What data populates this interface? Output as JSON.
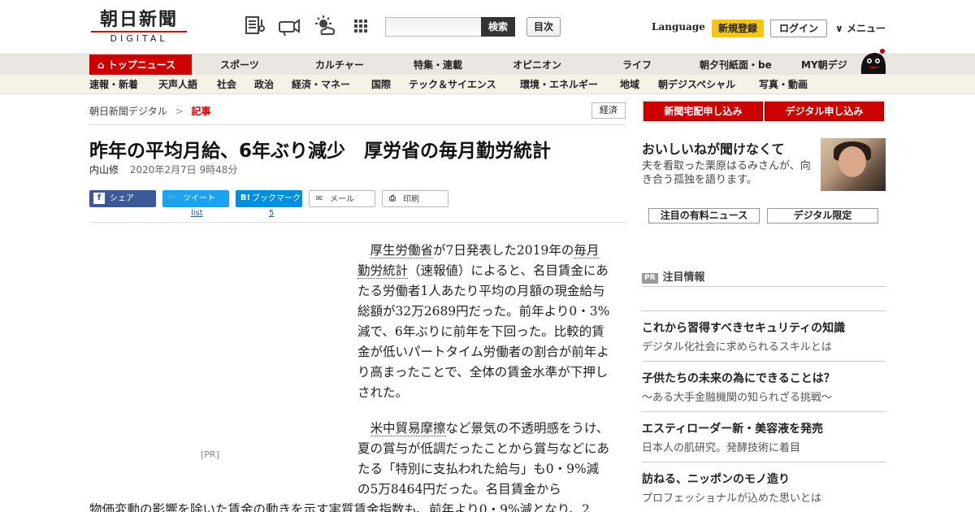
{
  "header": {
    "logo_main": "朝日新聞",
    "logo_sub": "DIGITAL",
    "search_placeholder": "",
    "search_button": "検索",
    "toc_button": "目次",
    "language": "Language",
    "register": "新規登録",
    "login": "ログイン",
    "menu": "メニュー",
    "icons": [
      "newspaper-icon",
      "megaphone-icon",
      "weather-icon",
      "grid-icon"
    ]
  },
  "nav1": [
    "トップニュース",
    "スポーツ",
    "カルチャー",
    "特集・連載",
    "オピニオン",
    "ライフ",
    "朝夕刊紙面・be",
    "MY朝デジ"
  ],
  "nav2": [
    "速報・新着",
    "天声人語",
    "社会",
    "政治",
    "経済・マネー",
    "国際",
    "テック＆サイエンス",
    "環境・エネルギー",
    "地域",
    "朝デジスペシャル",
    "写真・動画"
  ],
  "breadcrumb": {
    "home": "朝日新聞デジタル",
    "separator": ">",
    "current": "記事"
  },
  "category": "経済",
  "article": {
    "title": "昨年の平均月給、6年ぶり減少　厚労省の毎月勤労統計",
    "author": "内山修",
    "date": "2020年2月7日 9時48分",
    "p1_kw1": "厚生労働省",
    "p1_a": "が7日発表した2019年の",
    "p1_kw2": "毎月勤労統計",
    "p1_b": "（速報値）によると、名目賃金にあたる労働者1人あたり平均の月額の現金給与総額が32万2689円だった。前年より0・3%減で、6年ぶりに前年を下回った。比較的賃金が低いパートタイム労働者の割合が前年より高まったことで、全体の賃金水準が下押しされた。",
    "p2_kw1": "米中貿易摩擦",
    "p2_a": "など景気の不透明感をうけ、夏の賞与が低調だったことから賞与などにあたる「特別に支払われた給与」も0・9%減の5万8464円だった。名目賃金から",
    "p3": "物価変動の影響を除いた賃金の動きを示す実質賃金指数も、前年より0・9%減となり、2",
    "pr_label": "[PR]"
  },
  "share": {
    "facebook": "シェア",
    "twitter": "ツイート",
    "hatena": "ブックマーク",
    "mail": "メール",
    "print": "印刷",
    "twitter_count": "list",
    "hatena_count": "5"
  },
  "sidebar": {
    "subscribe_paper": "新聞宅配申し込み",
    "subscribe_digital": "デジタル申し込み",
    "promo_title": "おいしいねが聞けなくて",
    "promo_desc": "夫を看取った栗原はるみさんが、向き合う孤独を語ります。",
    "tab_paid": "注目の有料ニュース",
    "tab_digital": "デジタル限定",
    "pr_badge": "PR",
    "pr_header": "注目情報",
    "pr_items": [
      {
        "title": "これから習得すべきセキュリティの知識",
        "desc": "デジタル化社会に求められるスキルとは"
      },
      {
        "title": "子供たちの未来の為にできることは？",
        "desc": "～ある大手金融機関の知られざる挑戦～"
      },
      {
        "title": "エスティローダー新・美容液を発売",
        "desc": "日本人の肌研究。発酵技術に着目"
      },
      {
        "title": "訪ねる、ニッポンのモノ造り",
        "desc": "プロフェッショナルが込めた思いとは"
      }
    ]
  },
  "colors": {
    "brand_red": "#cc0000",
    "register_yellow": "#f5c518",
    "facebook": "#3b5998",
    "twitter": "#1da1f2",
    "hatena": "#008fde"
  }
}
